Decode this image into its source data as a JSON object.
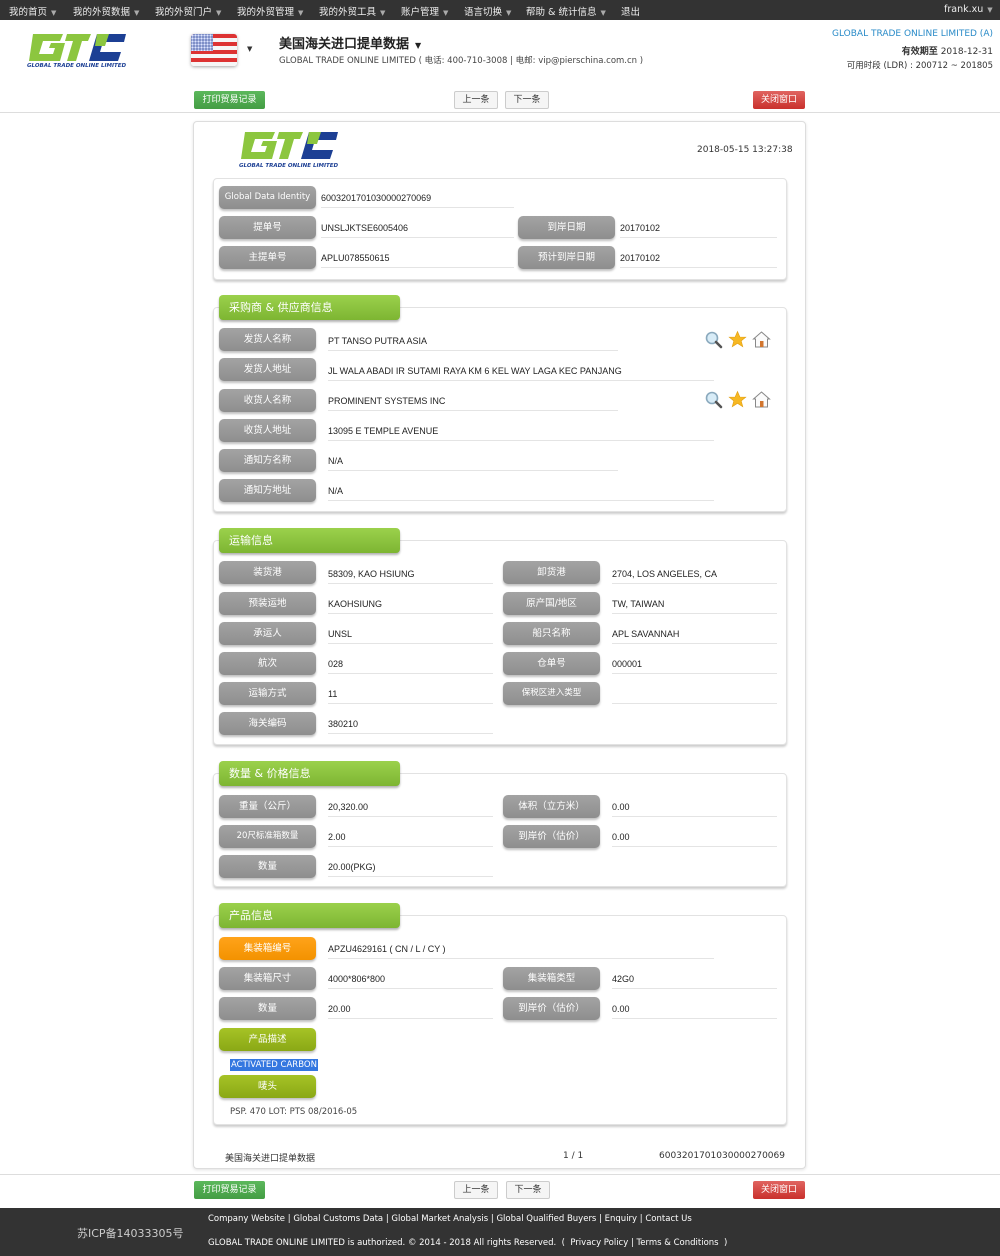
{
  "topnav": {
    "items": [
      "我的首页",
      "我的外贸数据",
      "我的外贸门户",
      "我的外贸管理",
      "我的外贸工具",
      "账户管理",
      "语言切换",
      "帮助 & 统计信息",
      "退出"
    ],
    "user": "frank.xu"
  },
  "header": {
    "logo_text": "GLOBAL TRADE ONLINE LIMITED",
    "country_flag": "us-flag-icon",
    "title": "美国海关进口提单数据",
    "contact": "GLOBAL TRADE ONLINE LIMITED ( 电话:  400-710-3008  | 电邮:  vip@pierschina.com.cn )",
    "company": "GLOBAL TRADE ONLINE LIMITED (A)",
    "expiry_label": "有效期至",
    "expiry_date": "2018-12-31",
    "ldr_label": "可用时段 (LDR) :",
    "ldr_range": "200712 ~ 201805"
  },
  "toolbar": {
    "print_label": "打印贸易记录",
    "prev_label": "上一条",
    "next_label": "下一条",
    "close_label": "关闭窗口"
  },
  "record": {
    "timestamp": "2018-05-15 13:27:38",
    "ident": {
      "gdi_label": "Global Data Identity",
      "gdi_value": "6003201701030000270069",
      "bol_label": "提单号",
      "bol_value": "UNSLJKTSE6005406",
      "arrival_label": "到岸日期",
      "arrival_value": "20170102",
      "master_bol_label": "主提单号",
      "master_bol_value": "APLU078550615",
      "est_arrival_label": "预计到岸日期",
      "est_arrival_value": "20170102"
    },
    "parties": {
      "title": "采购商 & 供应商信息",
      "shipper_name_label": "发货人名称",
      "shipper_name": "PT TANSO PUTRA ASIA",
      "shipper_addr_label": "发货人地址",
      "shipper_addr": "JL WALA ABADI IR SUTAMI RAYA KM 6 KEL WAY LAGA KEC PANJANG",
      "consignee_name_label": "收货人名称",
      "consignee_name": "PROMINENT SYSTEMS INC",
      "consignee_addr_label": "收货人地址",
      "consignee_addr": "13095 E TEMPLE AVENUE",
      "notify_name_label": "通知方名称",
      "notify_name": "N/A",
      "notify_addr_label": "通知方地址",
      "notify_addr": "N/A"
    },
    "transport": {
      "title": "运输信息",
      "load_port_label": "装货港",
      "load_port": "58309, KAO HSIUNG",
      "unload_port_label": "卸货港",
      "unload_port": "2704, LOS ANGELES, CA",
      "pre_carriage_label": "预装运地",
      "pre_carriage": "KAOHSIUNG",
      "origin_label": "原产国/地区",
      "origin": "TW, TAIWAN",
      "carrier_label": "承运人",
      "carrier": "UNSL",
      "vessel_label": "船只名称",
      "vessel": "APL SAVANNAH",
      "voyage_label": "航次",
      "voyage": "028",
      "manifest_label": "仓单号",
      "manifest": "000001",
      "mode_label": "运输方式",
      "mode": "11",
      "bonded_label": "保税区进入类型",
      "bonded": "",
      "hs_label": "海关编码",
      "hs": "380210"
    },
    "quantity": {
      "title": "数量 & 价格信息",
      "weight_label": "重量（公斤）",
      "weight": "20,320.00",
      "volume_label": "体积（立方米）",
      "volume": "0.00",
      "teu_label": "20尺标准箱数量",
      "teu": "2.00",
      "value_label": "到岸价（估价）",
      "value": "0.00",
      "qty_label": "数量",
      "qty": "20.00(PKG)"
    },
    "product": {
      "title": "产品信息",
      "container_no_label": "集装箱编号",
      "container_no": "APZU4629161 ( CN / L / CY )",
      "container_size_label": "集装箱尺寸",
      "container_size": "4000*806*800",
      "container_type_label": "集装箱类型",
      "container_type": "42G0",
      "qty_label": "数量",
      "qty": "20.00",
      "value_label": "到岸价（估价）",
      "value": "0.00",
      "desc_label": "产品描述",
      "desc": "ACTIVATED CARBON",
      "marks_label": "唛头",
      "marks": "PSP. 470 LOT: PTS 08/2016-05"
    },
    "footer": {
      "source": "美国海关进口提单数据",
      "page": "1 / 1",
      "id": "6003201701030000270069"
    }
  },
  "footer": {
    "icp": "苏ICP备14033305号",
    "links": [
      "Company Website",
      "Global Customs Data",
      "Global Market Analysis",
      "Global Qualified Buyers",
      "Enquiry",
      "Contact Us"
    ],
    "copyright": "GLOBAL TRADE ONLINE LIMITED is authorized. © 2014 - 2018 All rights Reserved.",
    "privacy": "Privacy Policy",
    "terms": "Terms & Conditions"
  }
}
